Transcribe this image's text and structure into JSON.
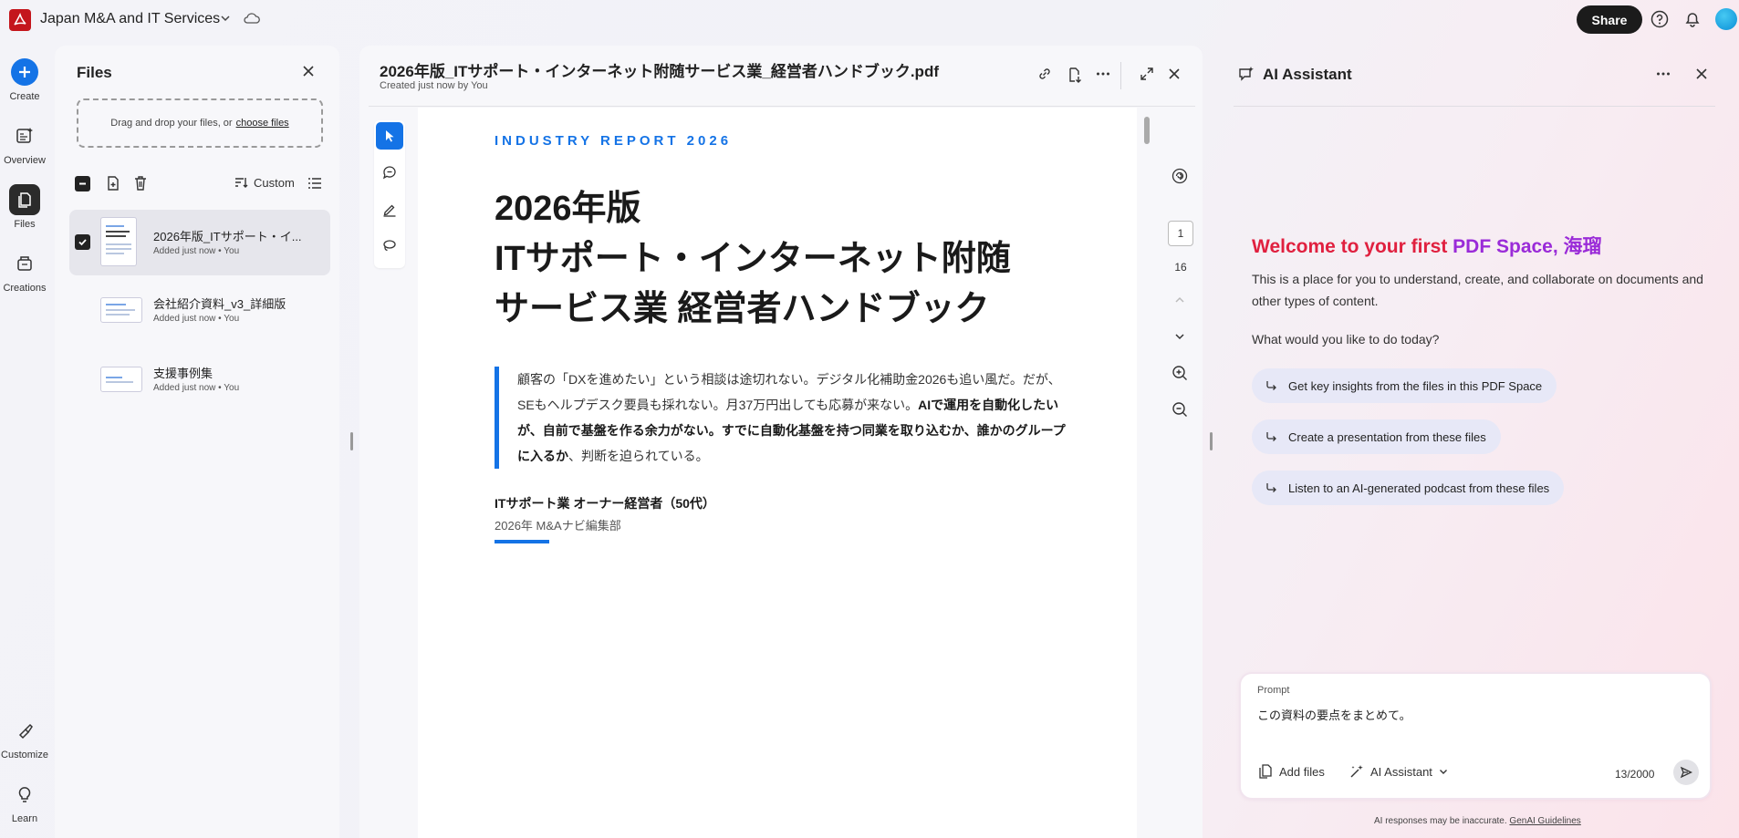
{
  "app": {
    "title": "Japan M&A and IT Services",
    "share_label": "Share"
  },
  "nav": {
    "create": "Create",
    "overview": "Overview",
    "files": "Files",
    "creations": "Creations",
    "customize": "Customize",
    "learn": "Learn"
  },
  "files_panel": {
    "title": "Files",
    "drop_text": "Drag and drop your files, or",
    "drop_link": "choose files",
    "sort_label": "Custom",
    "items": [
      {
        "name": "2026年版_ITサポート・イ...",
        "meta": "Added just now • You",
        "selected": true
      },
      {
        "name": "会社紹介資料_v3_詳細版",
        "meta": "Added just now • You",
        "selected": false
      },
      {
        "name": "支援事例集",
        "meta": "Added just now • You",
        "selected": false
      }
    ]
  },
  "document": {
    "filename": "2026年版_ITサポート・インターネット附随サービス業_経営者ハンドブック.pdf",
    "created": "Created just now by You",
    "current_page": "1",
    "total_pages": "16",
    "page": {
      "eyebrow": "INDUSTRY REPORT 2026",
      "title_line1": "2026年版",
      "title_line2": "ITサポート・インターネット附随",
      "title_line3": "サービス業 経営者ハンドブック",
      "quote_part1": "顧客の「DXを進めたい」という相談は途切れない。デジタル化補助金2026も追い風だ。だが、SEもヘルプデスク要員も採れない。月37万円出しても応募が来ない。",
      "quote_bold": "AIで運用を自動化したいが、自前で基盤を作る余力がない。すでに自動化基盤を持つ同業を取り込むか、誰かのグループに入るか",
      "quote_part2": "、判断を迫られている。",
      "author": "ITサポート業 オーナー経営者（50代）",
      "publisher": "2026年 M&Aナビ編集部"
    }
  },
  "ai": {
    "title": "AI Assistant",
    "welcome_red": "Welcome to your first ",
    "welcome_purple": "PDF Space, 海瑠",
    "description": "This is a place for you to understand, create, and collaborate on documents and other types of content.",
    "question": "What would you like to do today?",
    "suggestions": [
      "Get key insights from the files in this PDF Space",
      "Create a presentation from these files",
      "Listen to an AI-generated podcast from these files"
    ],
    "prompt_label": "Prompt",
    "prompt_value": "この資料の要点をまとめて。",
    "add_files": "Add files",
    "mode": "AI Assistant",
    "char_count": "13/2000",
    "disclaimer": "AI responses may be inaccurate.",
    "guidelines": "GenAI Guidelines"
  },
  "colors": {
    "accent_blue": "#1473e6",
    "brand_red": "#c4161c",
    "welcome_red": "#e0203f",
    "welcome_purple": "#9a2bd8"
  }
}
